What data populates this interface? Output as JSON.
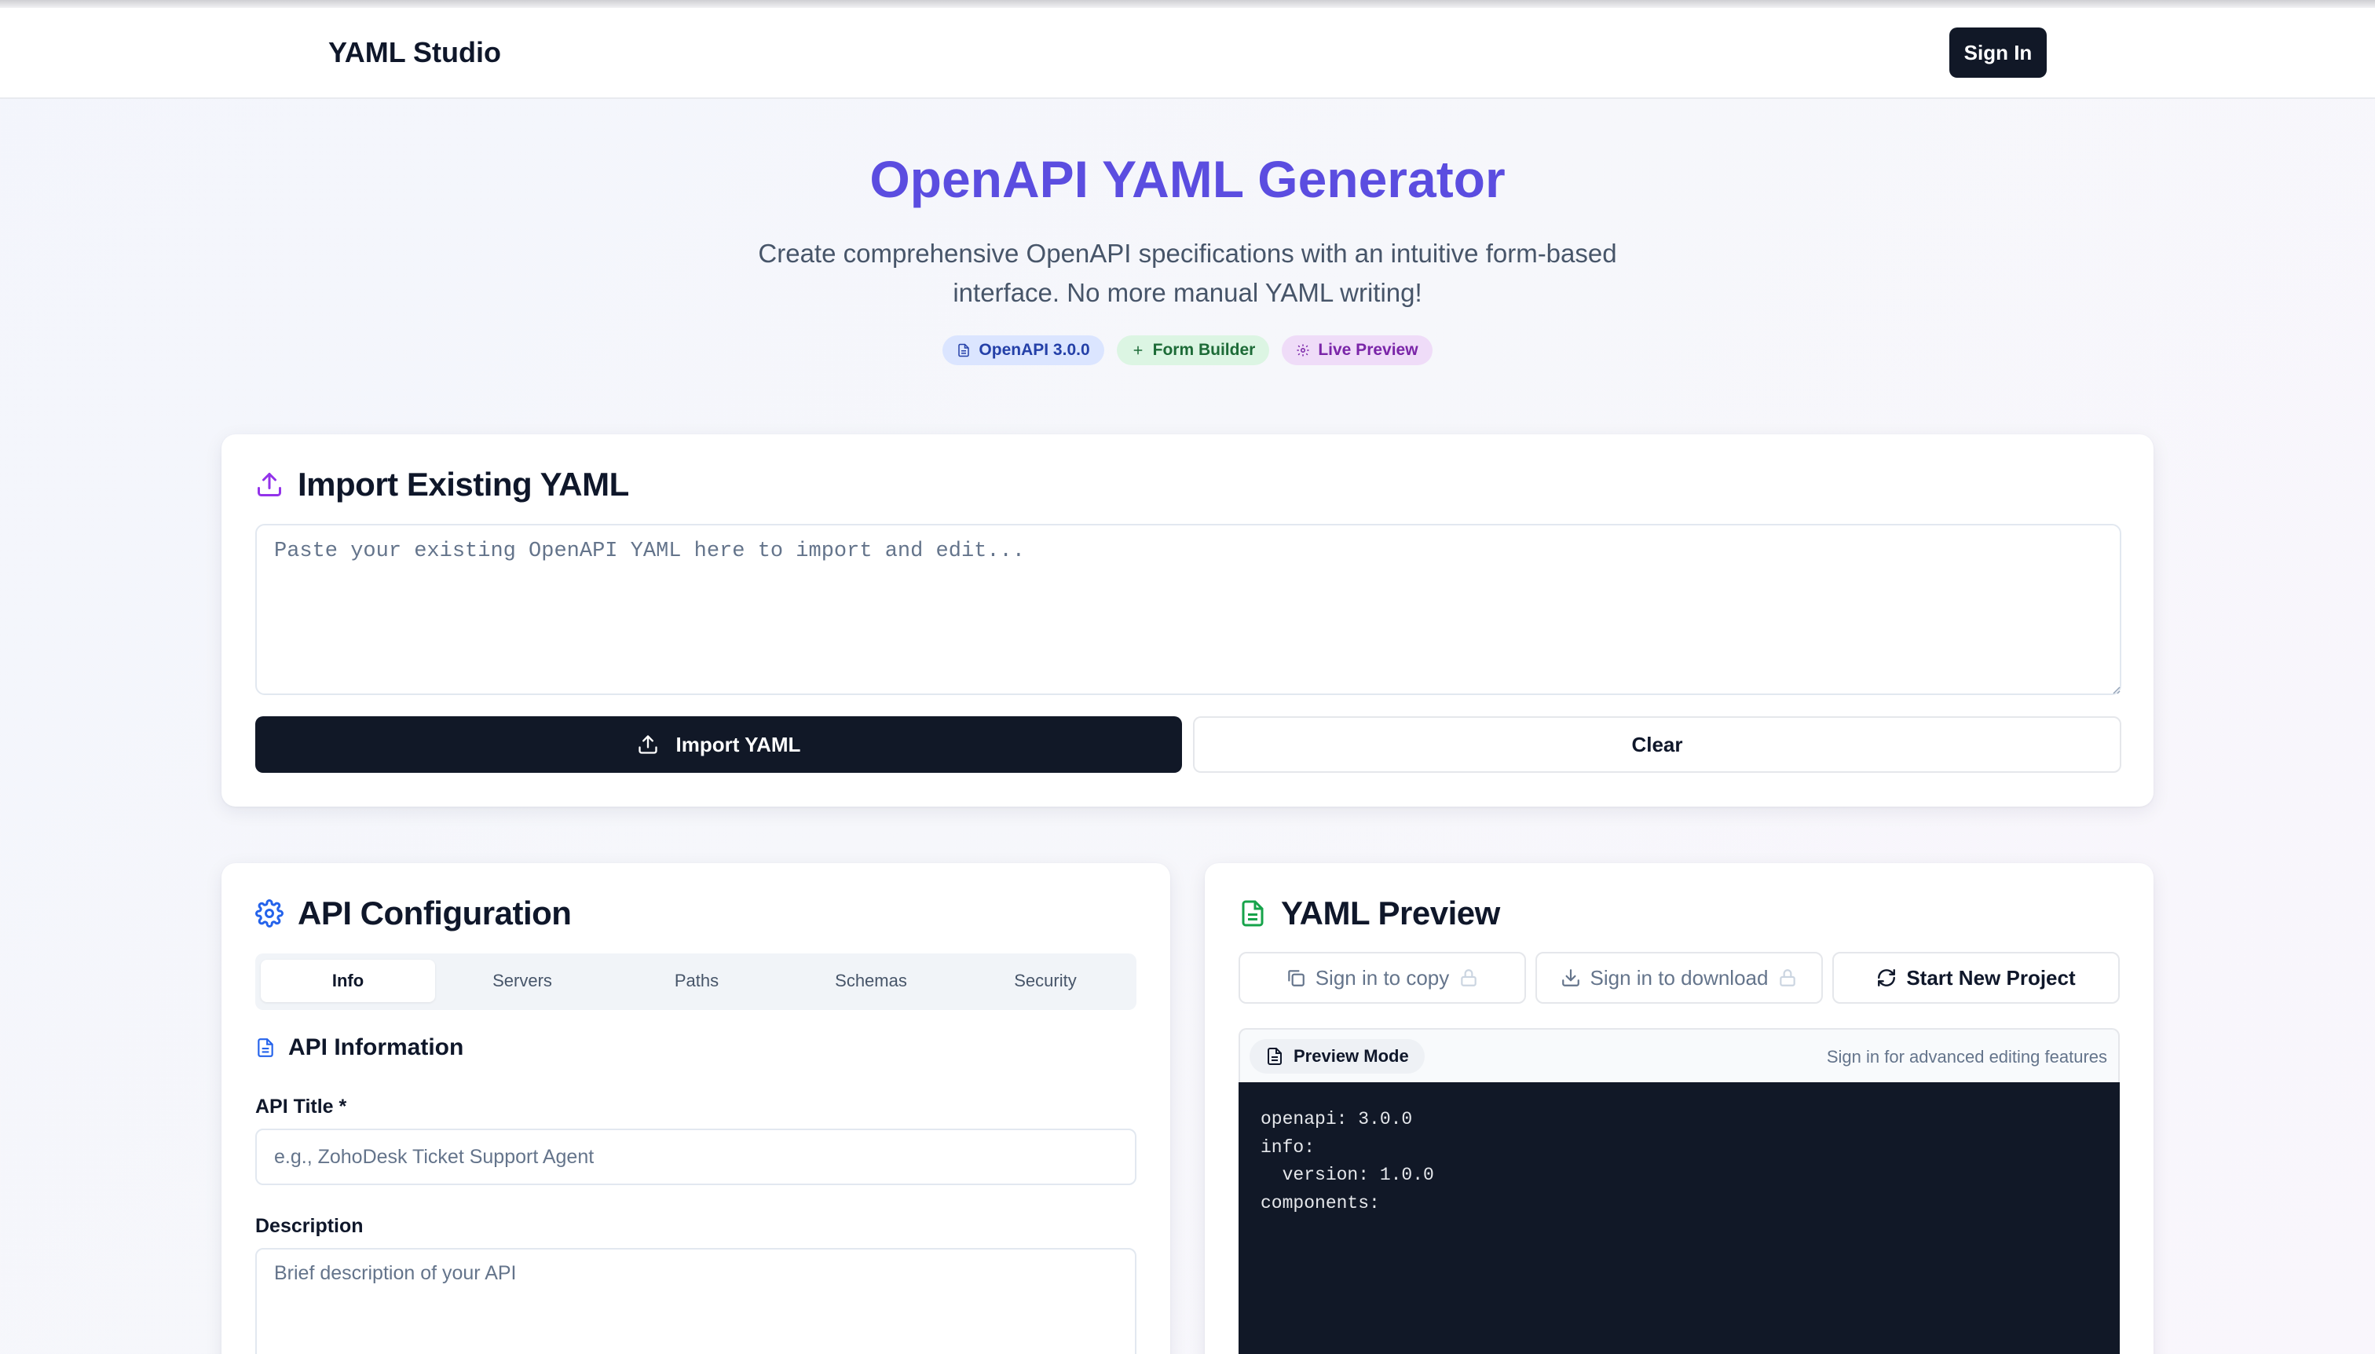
{
  "nav": {
    "brand": "YAML Studio",
    "signin_label": "Sign In"
  },
  "hero": {
    "title": "OpenAPI YAML Generator",
    "subtitle_line1": "Create comprehensive OpenAPI specifications with an intuitive form-based",
    "subtitle_line2": "interface. No more manual YAML writing!",
    "badges": [
      {
        "label": "OpenAPI 3.0.0",
        "icon": "file-icon"
      },
      {
        "label": "Form Builder",
        "icon": "plus-icon"
      },
      {
        "label": "Live Preview",
        "icon": "gear-icon"
      }
    ]
  },
  "import": {
    "title": "Import Existing YAML",
    "placeholder": "Paste your existing OpenAPI YAML here to import and edit...",
    "import_label": "Import YAML",
    "clear_label": "Clear"
  },
  "config": {
    "title": "API Configuration",
    "tabs": [
      "Info",
      "Servers",
      "Paths",
      "Schemas",
      "Security"
    ],
    "active_tab": "Info",
    "section_title": "API Information",
    "api_title_label": "API Title *",
    "api_title_placeholder": "e.g., ZohoDesk Ticket Support Agent",
    "description_label": "Description",
    "description_placeholder": "Brief description of your API"
  },
  "preview": {
    "title": "YAML Preview",
    "copy_label": "Sign in to copy",
    "download_label": "Sign in to download",
    "new_project_label": "Start New Project",
    "mode_label": "Preview Mode",
    "mode_note": "Sign in for advanced editing features",
    "code_lines": [
      "openapi: 3.0.0",
      "info:",
      "  version: 1.0.0",
      "components:"
    ]
  },
  "colors": {
    "accent": "#5b4de0",
    "dark": "#111827",
    "badge_blue_bg": "#dbe5ff",
    "badge_green_bg": "#dcf5e3",
    "badge_purple_bg": "#efdcf8",
    "import_icon": "#9333ea",
    "config_icon": "#2563eb",
    "preview_icon": "#16a34a"
  }
}
